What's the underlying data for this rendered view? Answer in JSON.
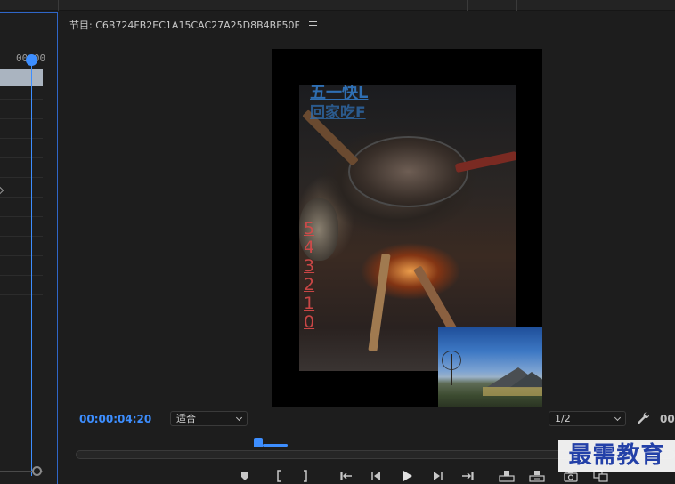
{
  "timeline": {
    "timecode": "00:00"
  },
  "monitor": {
    "title": "节目: C6B724FB2EC1A15CAC27A25D8B4BF50F",
    "frame": {
      "overlay_line1": "五一快L",
      "overlay_line2": "回家吃F",
      "countdown": [
        "5",
        "4",
        "3",
        "2",
        "1",
        "0"
      ]
    },
    "current_timecode": "00:00:04:20",
    "fit_select": "适合",
    "resolution_select": "1/2",
    "right_timecode": "00"
  },
  "watermark": {
    "text": "最需教育"
  },
  "colors": {
    "accent": "#3d8eff",
    "panel": "#1d1d1d",
    "countdown": "#d94a4a",
    "overlay_text": "#2f6fb3",
    "watermark_text": "#2340a8"
  },
  "icons": {
    "wrench": "wrench-icon",
    "marker": "add-marker-icon",
    "mark_in": "mark-in-icon",
    "mark_out": "mark-out-icon",
    "go_to_in": "go-to-in-icon",
    "step_back": "step-back-icon",
    "play": "play-icon",
    "step_forward": "step-forward-icon",
    "go_to_out": "go-to-out-icon",
    "lift": "lift-icon",
    "extract": "extract-icon",
    "export_frame": "camera-icon",
    "compare": "comparison-view-icon"
  }
}
